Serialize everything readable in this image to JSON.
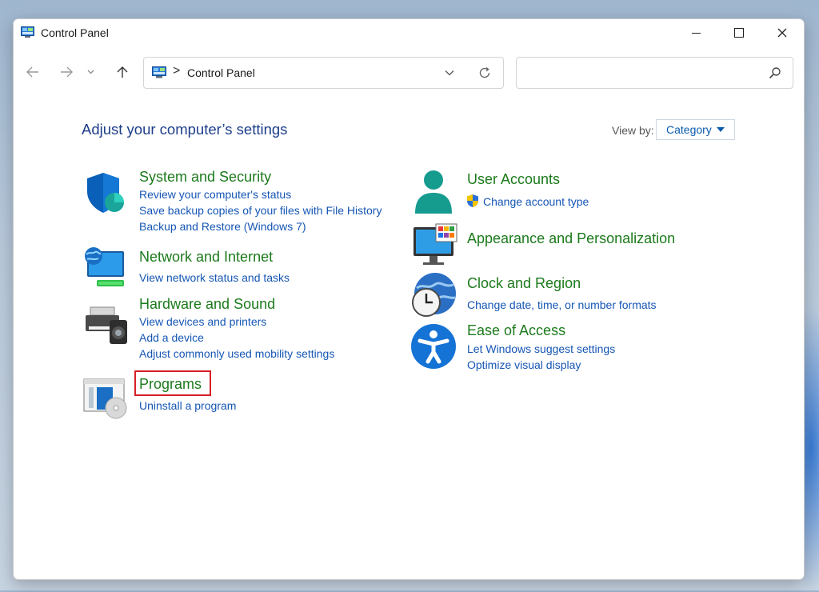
{
  "window": {
    "title": "Control Panel"
  },
  "titlebar_buttons": [
    "minimize",
    "maximize",
    "close"
  ],
  "navigation": {
    "icons": [
      "back-arrow-icon",
      "forward-arrow-icon",
      "chevron-down-icon",
      "up-arrow-icon"
    ]
  },
  "address": {
    "separator": ">",
    "path": "Control Panel"
  },
  "search": {
    "placeholder": ""
  },
  "main": {
    "heading": "Adjust your computer’s settings",
    "view_by_label": "View by:",
    "view_by_value": "Category"
  },
  "categories_left": [
    {
      "title": "System and Security",
      "icon": "shield-icon",
      "links": [
        "Review your computer's status",
        "Save backup copies of your files with File History",
        "Backup and Restore (Windows 7)"
      ]
    },
    {
      "title": "Network and Internet",
      "icon": "network-globe-icon",
      "links": [
        "View network status and tasks"
      ]
    },
    {
      "title": "Hardware and Sound",
      "icon": "printer-speaker-icon",
      "links": [
        "View devices and printers",
        "Add a device",
        "Adjust commonly used mobility settings"
      ]
    },
    {
      "title": "Programs",
      "icon": "programs-disc-icon",
      "links": [
        "Uninstall a program"
      ],
      "highlighted": true
    }
  ],
  "categories_right": [
    {
      "title": "User Accounts",
      "icon": "user-icon",
      "links": [
        "Change account type"
      ]
    },
    {
      "title": "Appearance and Personalization",
      "icon": "monitor-palette-icon",
      "links": []
    },
    {
      "title": "Clock and Region",
      "icon": "clock-globe-icon",
      "links": [
        "Change date, time, or number formats"
      ]
    },
    {
      "title": "Ease of Access",
      "icon": "accessibility-icon",
      "links": [
        "Let Windows suggest settings",
        "Optimize visual display"
      ]
    }
  ],
  "colors": {
    "category_title": "#1c7a1c",
    "link": "#1556b4",
    "heading": "#1e3e8a",
    "highlight_border": "#d81f26"
  }
}
